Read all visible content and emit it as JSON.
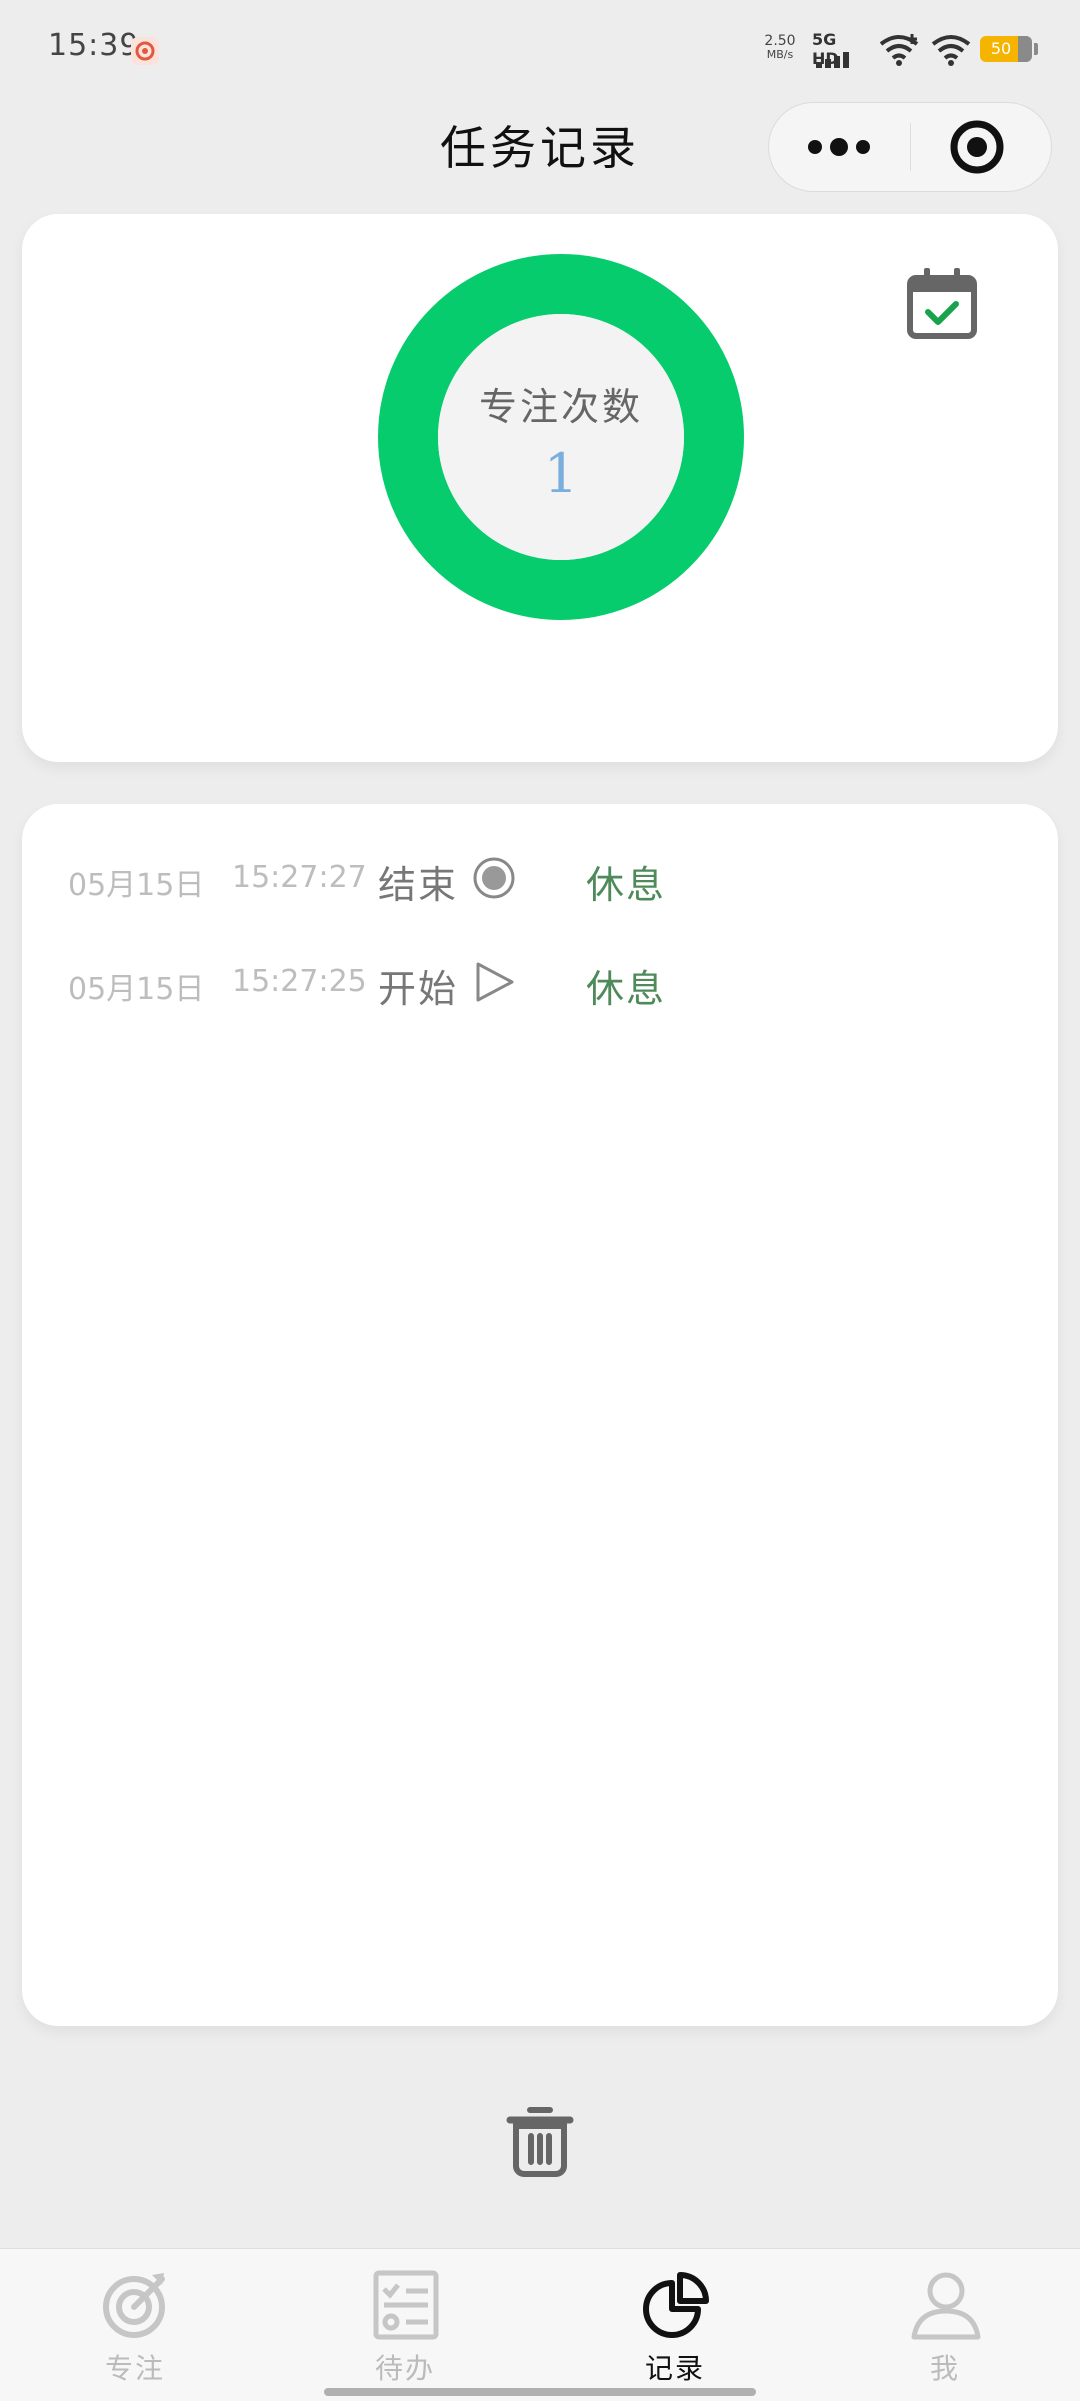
{
  "status_bar": {
    "time": "15:39",
    "net_speed_value": "2.50",
    "net_speed_unit": "MB/s",
    "network": "5G HD",
    "battery": "50",
    "battery_color": "#f5b400"
  },
  "header": {
    "title": "任务记录",
    "more_icon": "more-dots-icon",
    "close_icon": "target-close-icon"
  },
  "stats": {
    "label": "专注次数",
    "value": "1",
    "ring_color": "#07cc6e",
    "calendar_icon": "calendar-check-icon"
  },
  "records": [
    {
      "date": "05月15日",
      "time": "15:27:27",
      "action": "结束",
      "action_icon": "stop-circle-icon",
      "type": "休息"
    },
    {
      "date": "05月15日",
      "time": "15:27:25",
      "action": "开始",
      "action_icon": "play-triangle-icon",
      "type": "休息"
    }
  ],
  "trash_icon": "trash-icon",
  "tabs": [
    {
      "label": "专注",
      "icon": "focus-target-icon",
      "active": false
    },
    {
      "label": "待办",
      "icon": "checklist-icon",
      "active": false
    },
    {
      "label": "记录",
      "icon": "pie-chart-icon",
      "active": true
    },
    {
      "label": "我",
      "icon": "user-icon",
      "active": false
    }
  ]
}
